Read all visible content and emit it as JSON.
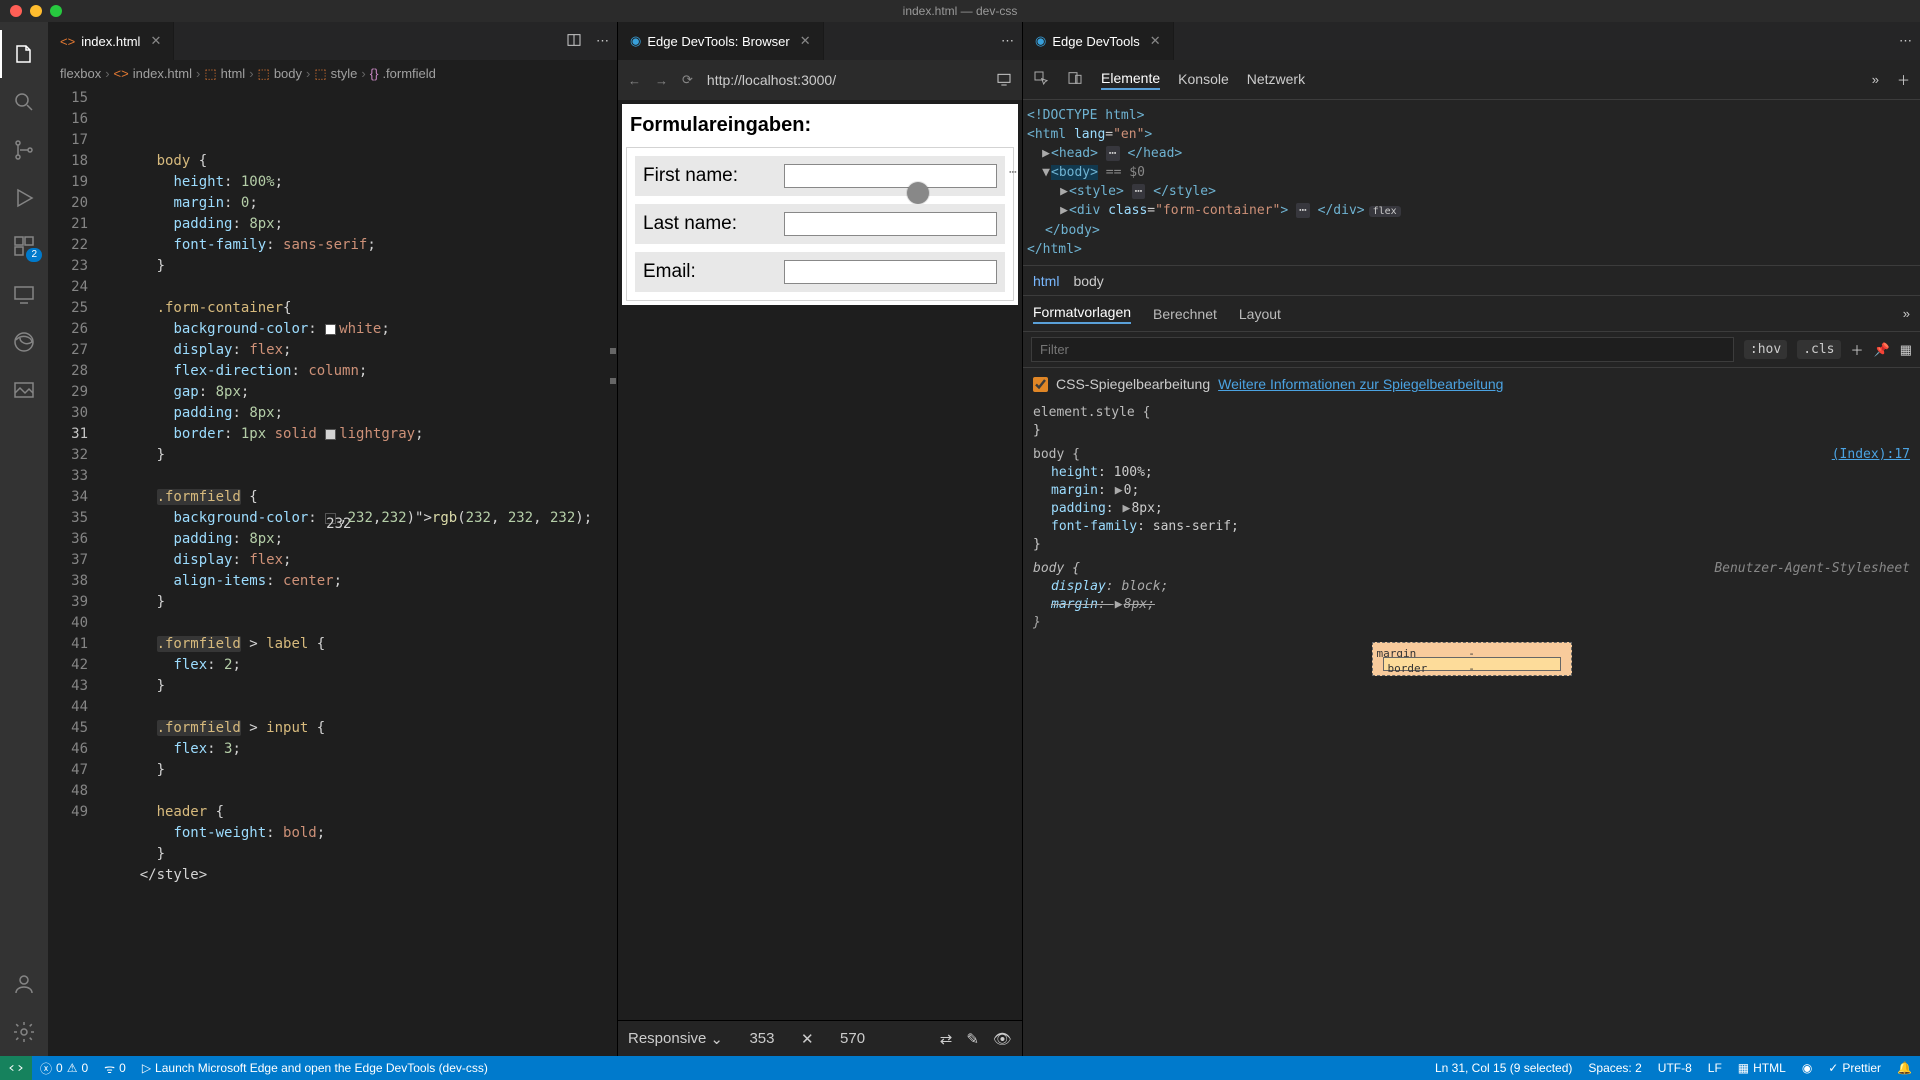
{
  "window": {
    "title": "index.html — dev-css"
  },
  "tabs": {
    "editor": {
      "label": "index.html",
      "icon_color": "#e37933"
    },
    "browser": {
      "label": "Edge DevTools: Browser"
    },
    "devtools": {
      "label": "Edge DevTools"
    }
  },
  "breadcrumb": [
    "flexbox",
    "index.html",
    "html",
    "body",
    "style",
    ".formfield"
  ],
  "activity_badge": "2",
  "code": {
    "lines": [
      {
        "n": 15,
        "t": "      body {"
      },
      {
        "n": 16,
        "t": "        height: 100%;"
      },
      {
        "n": 17,
        "t": "        margin: 0;"
      },
      {
        "n": 18,
        "t": "        padding: 8px;"
      },
      {
        "n": 19,
        "t": "        font-family: sans-serif;"
      },
      {
        "n": 20,
        "t": "      }"
      },
      {
        "n": 21,
        "t": ""
      },
      {
        "n": 22,
        "t": "      .form-container{"
      },
      {
        "n": 23,
        "t": "        background-color: white;"
      },
      {
        "n": 24,
        "t": "        display: flex;"
      },
      {
        "n": 25,
        "t": "        flex-direction: column;"
      },
      {
        "n": 26,
        "t": "        gap: 8px;"
      },
      {
        "n": 27,
        "t": "        padding: 8px;"
      },
      {
        "n": 28,
        "t": "        border: 1px solid lightgray;"
      },
      {
        "n": 29,
        "t": "      }"
      },
      {
        "n": 30,
        "t": ""
      },
      {
        "n": 31,
        "t": "      .formfield {"
      },
      {
        "n": 32,
        "t": "        background-color: rgb(232, 232, 232);"
      },
      {
        "n": 33,
        "t": "        padding: 8px;"
      },
      {
        "n": 34,
        "t": "        display: flex;"
      },
      {
        "n": 35,
        "t": "        align-items: center;"
      },
      {
        "n": 36,
        "t": "      }"
      },
      {
        "n": 37,
        "t": ""
      },
      {
        "n": 38,
        "t": "      .formfield > label {"
      },
      {
        "n": 39,
        "t": "        flex: 2;"
      },
      {
        "n": 40,
        "t": "      }"
      },
      {
        "n": 41,
        "t": ""
      },
      {
        "n": 42,
        "t": "      .formfield > input {"
      },
      {
        "n": 43,
        "t": "        flex: 3;"
      },
      {
        "n": 44,
        "t": "      }"
      },
      {
        "n": 45,
        "t": ""
      },
      {
        "n": 46,
        "t": "      header {"
      },
      {
        "n": 47,
        "t": "        font-weight: bold;"
      },
      {
        "n": 48,
        "t": "      }"
      },
      {
        "n": 49,
        "t": "    </style>"
      }
    ]
  },
  "browser": {
    "url": "http://localhost:3000/",
    "page": {
      "header": "Formulareingaben:",
      "fields": [
        {
          "label": "First name:"
        },
        {
          "label": "Last name:"
        },
        {
          "label": "Email:"
        }
      ]
    },
    "device": {
      "mode": "Responsive",
      "width": "353",
      "height": "570"
    }
  },
  "devtools": {
    "tabs": [
      "Elemente",
      "Konsole",
      "Netzwerk"
    ],
    "dom_breadcrumb": [
      "html",
      "body"
    ],
    "styles_tabs": [
      "Formatvorlagen",
      "Berechnet",
      "Layout"
    ],
    "filter_placeholder": "Filter",
    "hov": ":hov",
    "cls": ".cls",
    "mirror": {
      "checkbox_label": "CSS-Spiegelbearbeitung",
      "link": "Weitere Informationen zur Spiegelbearbeitung"
    },
    "dom": {
      "doctype": "<!DOCTYPE html>",
      "html_open": "<html lang=\"en\">",
      "head": "<head>",
      "head_close": "</head>",
      "body": "<body>",
      "body_eq": " == $0",
      "style": "<style>",
      "style_close": "</style>",
      "div": "<div class=\"form-container\">",
      "div_close": "</div>",
      "flex_badge": "flex",
      "body_close": "</body>",
      "html_close": "</html>"
    },
    "styles": {
      "element_style": "element.style {",
      "body_sel": "body {",
      "index_link": "(Index):17",
      "rules": [
        {
          "p": "height",
          "v": "100%;"
        },
        {
          "p": "margin",
          "v": "0;",
          "tri": true
        },
        {
          "p": "padding",
          "v": "8px;",
          "tri": true
        },
        {
          "p": "font-family",
          "v": "sans-serif;"
        }
      ],
      "ua_label": "Benutzer-Agent-Stylesheet",
      "ua_rules": [
        {
          "p": "display",
          "v": "block;"
        },
        {
          "p": "margin",
          "v": "8px;",
          "strike": true,
          "tri": true
        }
      ]
    },
    "box_model": {
      "margin_label": "margin",
      "border_label": "border",
      "dash": "-"
    }
  },
  "status": {
    "errors": "0",
    "warnings": "0",
    "port": "0",
    "launch": "Launch Microsoft Edge and open the Edge DevTools (dev-css)",
    "cursor": "Ln 31, Col 15 (9 selected)",
    "spaces": "Spaces: 2",
    "encoding": "UTF-8",
    "eol": "LF",
    "lang": "HTML",
    "prettier": "Prettier"
  }
}
